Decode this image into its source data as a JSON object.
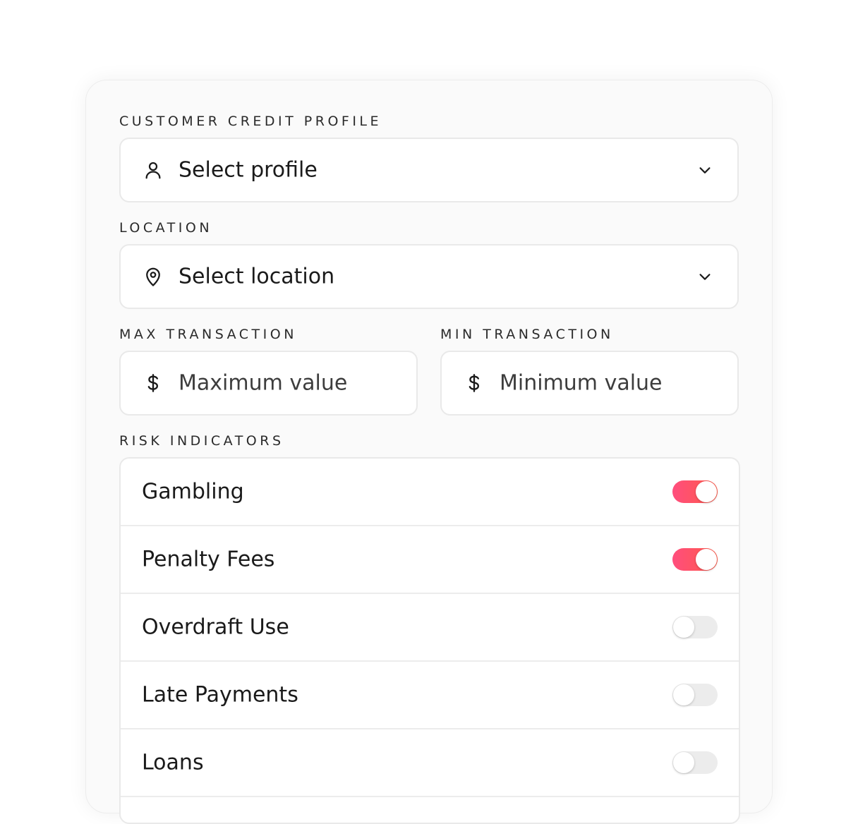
{
  "profile": {
    "label": "CUSTOMER CREDIT PROFILE",
    "placeholder": "Select profile",
    "icon": "user-icon"
  },
  "location": {
    "label": "LOCATION",
    "placeholder": "Select location",
    "icon": "map-pin-icon"
  },
  "max_transaction": {
    "label": "MAX TRANSACTION",
    "placeholder": "Maximum value",
    "icon": "dollar-icon"
  },
  "min_transaction": {
    "label": "MIN TRANSACTION",
    "placeholder": "Minimum value",
    "icon": "dollar-icon"
  },
  "risk": {
    "label": "RISK INDICATORS",
    "items": [
      {
        "label": "Gambling",
        "enabled": true
      },
      {
        "label": "Penalty Fees",
        "enabled": true
      },
      {
        "label": "Overdraft Use",
        "enabled": false
      },
      {
        "label": "Late Payments",
        "enabled": false
      },
      {
        "label": "Loans",
        "enabled": false
      }
    ]
  },
  "colors": {
    "toggle_on_start": "#ff4d7d",
    "toggle_on_end": "#ff5b4a",
    "toggle_off": "#ececec"
  }
}
